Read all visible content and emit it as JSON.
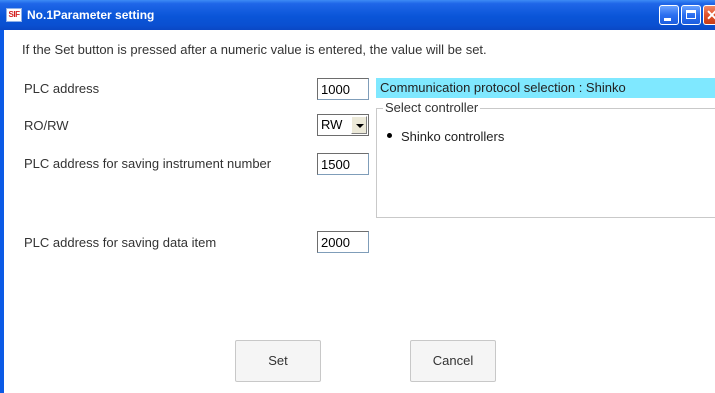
{
  "window": {
    "icon_text": "SIF",
    "title": "No.1Parameter setting"
  },
  "instruction": "If the Set button is pressed after a numeric value is entered, the value will be set.",
  "fields": {
    "plc_address": {
      "label": "PLC address",
      "value": "1000"
    },
    "ro_rw": {
      "label": "RO/RW",
      "value": "RW"
    },
    "instrument_number_address": {
      "label": "PLC address for saving instrument number",
      "value": "1500"
    },
    "data_item_address": {
      "label": "PLC address for saving data item",
      "value": "2000"
    }
  },
  "protocol_banner": "Communication protocol selection : Shinko",
  "select_controller": {
    "legend": "Select controller",
    "option_label": "Shinko controllers",
    "selected": true
  },
  "buttons": {
    "set": "Set",
    "cancel": "Cancel"
  },
  "colors": {
    "titlebar": "#0a55d8",
    "protocol_banner_bg": "#7fe8ff"
  }
}
